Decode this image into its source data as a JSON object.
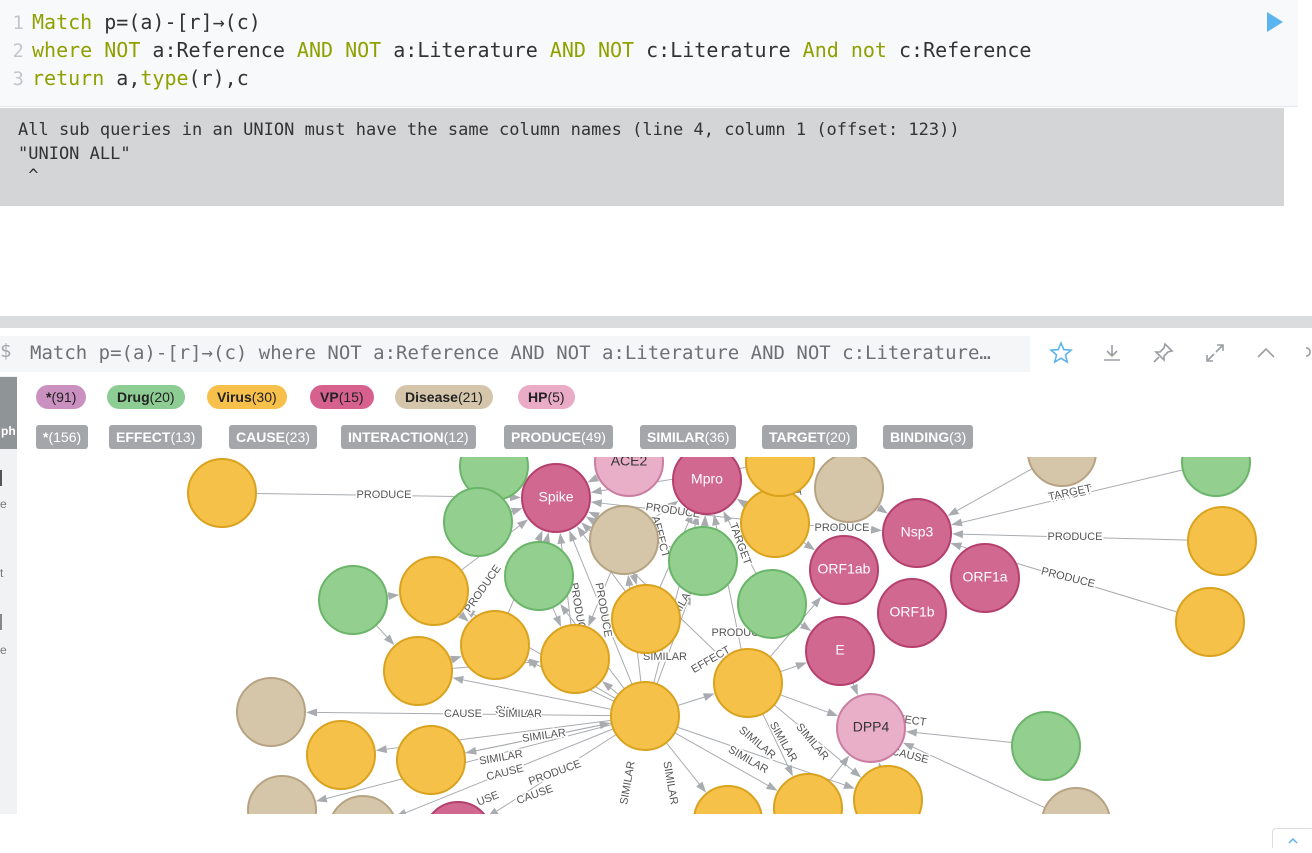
{
  "editor": {
    "lines": [
      {
        "num": "1",
        "parts": [
          {
            "t": "kw",
            "v": "Match"
          },
          {
            "t": "tx",
            "v": " p=(a)-[r]→(c)"
          }
        ]
      },
      {
        "num": "2",
        "parts": [
          {
            "t": "kw",
            "v": "where NOT"
          },
          {
            "t": "tx",
            "v": " a:Reference "
          },
          {
            "t": "kw",
            "v": "AND NOT"
          },
          {
            "t": "tx",
            "v": " a:Literature "
          },
          {
            "t": "kw",
            "v": "AND NOT"
          },
          {
            "t": "tx",
            "v": " c:Literature "
          },
          {
            "t": "kw",
            "v": "And not"
          },
          {
            "t": "tx",
            "v": " c:Reference"
          }
        ]
      },
      {
        "num": "3",
        "parts": [
          {
            "t": "kw",
            "v": "return"
          },
          {
            "t": "tx",
            "v": " a,"
          },
          {
            "t": "kw",
            "v": "type"
          },
          {
            "t": "tx",
            "v": "(r),c"
          }
        ]
      }
    ],
    "run_icon": "play-icon",
    "accent_color": "#5bb4f0"
  },
  "error": {
    "line1": "All sub queries in an UNION must have the same column names (line 4, column 1 (offset: 123))",
    "line2": "\"UNION ALL\"",
    "line3": " ^"
  },
  "frame": {
    "prompt": "$",
    "query": "Match p=(a)-[r]→(c) where NOT a:Reference AND NOT a:Literature AND NOT c:Literature…",
    "actions": [
      "star-icon",
      "download-icon",
      "pin-icon",
      "expand-icon",
      "collapse-icon"
    ]
  },
  "sidebar": {
    "graph_tab": "ph",
    "items": [
      "e",
      "t",
      "e"
    ]
  },
  "legend": {
    "labels": [
      {
        "name": "*",
        "count": "(91)",
        "color": "#c990c0"
      },
      {
        "name": "Drug",
        "count": "(20)",
        "color": "#8dcc93"
      },
      {
        "name": "Virus",
        "count": "(30)",
        "color": "#f7c04b"
      },
      {
        "name": "VP",
        "count": "(15)",
        "color": "#d6618f"
      },
      {
        "name": "Disease",
        "count": "(21)",
        "color": "#d5c6ab"
      },
      {
        "name": "HP",
        "count": "(5)",
        "color": "#eaabc7"
      }
    ],
    "relationships": [
      {
        "name": "*",
        "count": "(156)"
      },
      {
        "name": "EFFECT",
        "count": "(13)"
      },
      {
        "name": "CAUSE",
        "count": "(23)"
      },
      {
        "name": "INTERACTION",
        "count": "(12)"
      },
      {
        "name": "PRODUCE",
        "count": "(49)"
      },
      {
        "name": "SIMILAR",
        "count": "(36)"
      },
      {
        "name": "TARGET",
        "count": "(20)"
      },
      {
        "name": "BINDING",
        "count": "(3)"
      }
    ]
  },
  "graph": {
    "colors": {
      "Drug": "#93cf8f",
      "Drug_border": "#6ab56a",
      "Virus": "#f6c148",
      "Virus_border": "#d9a21f",
      "VP": "#d0688f",
      "VP_border": "#b5406e",
      "Disease": "#d6c6a9",
      "Disease_border": "#b6a383",
      "HP": "#e9aec8",
      "HP_border": "#c97ea1",
      "edge": "#a8acb0"
    },
    "named_nodes": [
      {
        "id": "spike",
        "label": "Spike",
        "type": "VP"
      },
      {
        "id": "ace2",
        "label": "ACE2",
        "type": "HP"
      },
      {
        "id": "mpro",
        "label": "Mpro",
        "type": "VP"
      },
      {
        "id": "nsp3",
        "label": "Nsp3",
        "type": "VP"
      },
      {
        "id": "orf1ab",
        "label": "ORF1ab",
        "type": "VP"
      },
      {
        "id": "orf1a",
        "label": "ORF1a",
        "type": "VP"
      },
      {
        "id": "orf1b",
        "label": "ORF1b",
        "type": "VP"
      },
      {
        "id": "e",
        "label": "E",
        "type": "VP"
      },
      {
        "id": "dpp4",
        "label": "DPP4",
        "type": "HP"
      }
    ],
    "edge_labels": [
      "PRODUCE",
      "TARGET",
      "PRODUCE",
      "PRODUCE",
      "CAUSE",
      "SIMILAR",
      "SIMILAR",
      "SIMILAR",
      "CAUSE",
      "SIMILAR",
      "PRODUCE",
      "USE",
      "CAUSE",
      "EFFECT",
      "CAUSE",
      "SIMILAR",
      "PRODUCE",
      "TARGET",
      "SIMILAR",
      "PRODUCE",
      "EFFECT",
      "PRODUCE",
      "SIMILAR",
      "AFFECT",
      "PRODUCE",
      "PRODUCE",
      "SIMILAR",
      "SIMILAR",
      "SIMILAR",
      "SIMILAR",
      "SIMILAR",
      "PRODUCE",
      "TARGET",
      "ECT"
    ]
  }
}
